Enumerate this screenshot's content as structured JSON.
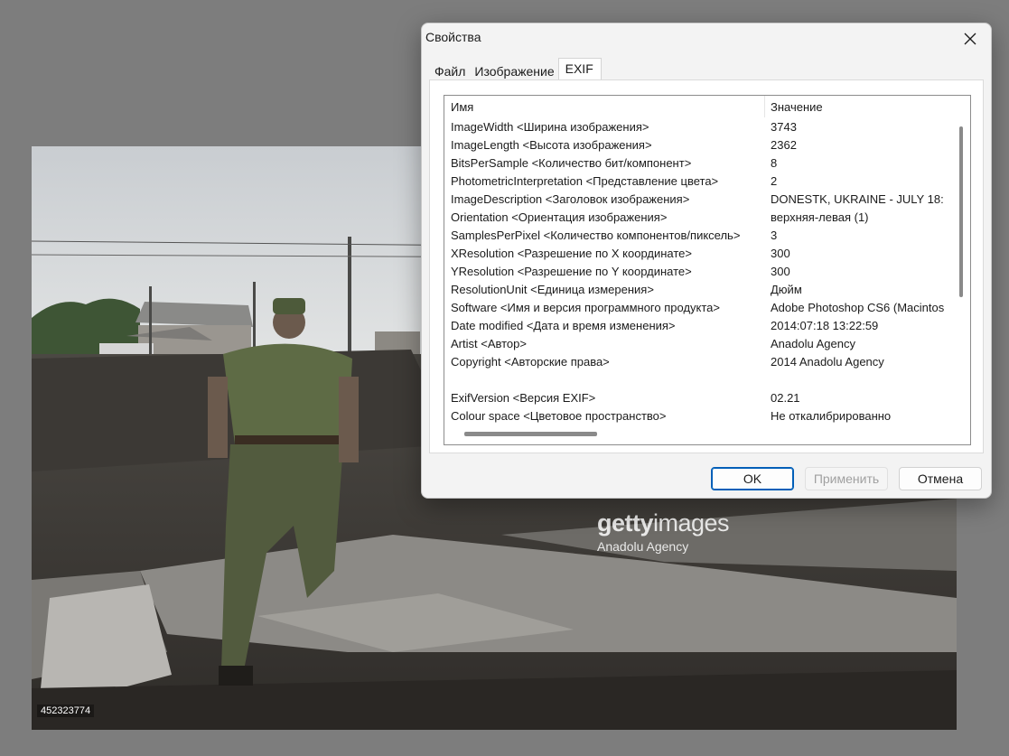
{
  "photo": {
    "id_label": "452323774",
    "watermark_logo_bold": "getty",
    "watermark_logo_regular": "images",
    "watermark_credit": "Anadolu Agency"
  },
  "dialog": {
    "title": "Свойства",
    "tabs": [
      {
        "label": "Файл",
        "active": false
      },
      {
        "label": "Изображение",
        "active": false
      },
      {
        "label": "EXIF",
        "active": true
      }
    ],
    "columns": {
      "name": "Имя",
      "value": "Значение"
    },
    "rows": [
      {
        "name": "ImageWidth <Ширина изображения>",
        "value": "3743"
      },
      {
        "name": "ImageLength <Высота изображения>",
        "value": "2362"
      },
      {
        "name": "BitsPerSample <Количество бит/компонент>",
        "value": "8"
      },
      {
        "name": "PhotometricInterpretation <Представление цвета>",
        "value": "2"
      },
      {
        "name": "ImageDescription <Заголовок изображения>",
        "value": "DONESTK, UKRAINE - JULY 18:"
      },
      {
        "name": "Orientation <Ориентация изображения>",
        "value": "верхняя-левая (1)"
      },
      {
        "name": "SamplesPerPixel <Количество компонентов/пиксель>",
        "value": "3"
      },
      {
        "name": "XResolution <Разрешение по X координате>",
        "value": "300"
      },
      {
        "name": "YResolution <Разрешение по Y координате>",
        "value": "300"
      },
      {
        "name": "ResolutionUnit <Единица измерения>",
        "value": "Дюйм"
      },
      {
        "name": "Software <Имя и версия программного продукта>",
        "value": "Adobe Photoshop CS6 (Macintos"
      },
      {
        "name": "Date modified <Дата и время изменения>",
        "value": "2014:07:18 13:22:59"
      },
      {
        "name": "Artist <Автор>",
        "value": "Anadolu Agency"
      },
      {
        "name": "Copyright <Авторские права>",
        "value": "2014 Anadolu Agency"
      },
      {
        "name": "",
        "value": ""
      },
      {
        "name": "ExifVersion <Версия EXIF>",
        "value": "02.21"
      },
      {
        "name": "Colour space <Цветовое пространство>",
        "value": "Не откалибрированно"
      }
    ],
    "buttons": {
      "ok": "OK",
      "apply": "Применить",
      "cancel": "Отмена"
    },
    "accent_color": "#005fb8"
  }
}
